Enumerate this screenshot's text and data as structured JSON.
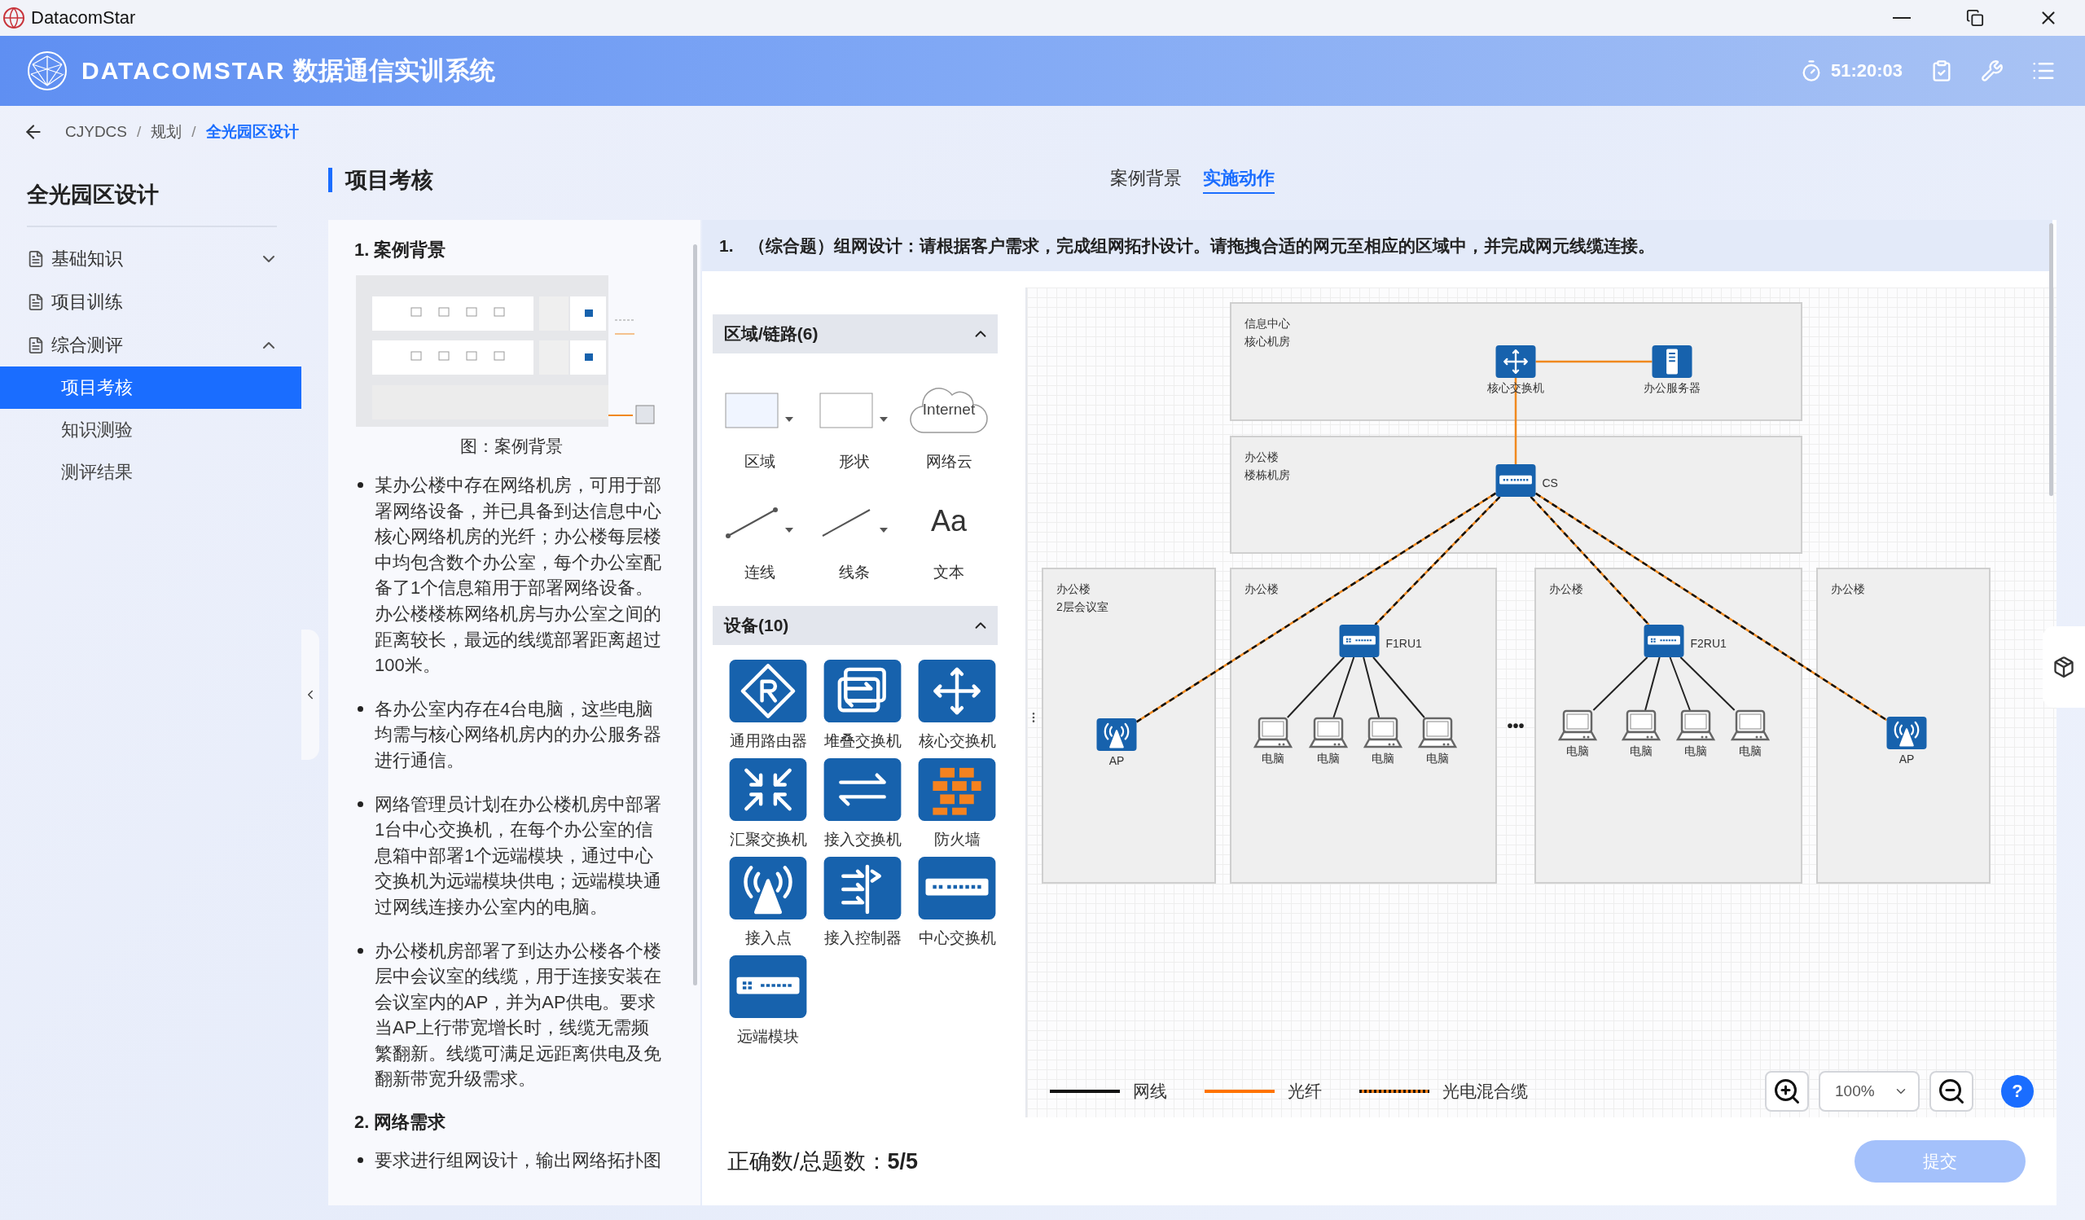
{
  "window": {
    "title": "DatacomStar"
  },
  "header": {
    "brand": "DATACOMSTAR",
    "title": "数据通信实训系统",
    "timer": "51:20:03"
  },
  "breadcrumb": {
    "separator": "/",
    "items": [
      {
        "label": "CJYDCS",
        "selected": false
      },
      {
        "label": "规划",
        "selected": false
      },
      {
        "label": "全光园区设计",
        "selected": true
      }
    ]
  },
  "sidebar": {
    "title": "全光园区设计",
    "items": [
      {
        "label": "基础知识",
        "expanded": false
      },
      {
        "label": "项目训练"
      },
      {
        "label": "综合测评",
        "expanded": true,
        "children": [
          {
            "label": "项目考核",
            "selected": true
          },
          {
            "label": "知识测验",
            "selected": false
          },
          {
            "label": "测评结果",
            "selected": false
          }
        ]
      }
    ]
  },
  "section": {
    "title": "项目考核",
    "tabs": [
      {
        "label": "案例背景",
        "selected": false
      },
      {
        "label": "实施动作",
        "selected": true
      }
    ]
  },
  "case_panel": {
    "heading": "1. 案例背景",
    "figure_caption": "图：案例背景",
    "bullets": [
      "某办公楼中存在网络机房，可用于部署网络设备，并已具备到达信息中心核心网络机房的光纤；办公楼每层楼中均包含数个办公室，每个办公室配备了1个信息箱用于部署网络设备。办公楼楼栋网络机房与办公室之间的距离较长，最远的线缆部署距离超过100米。",
      "各办公室内存在4台电脑，这些电脑均需与核心网络机房内的办公服务器进行通信。",
      "网络管理员计划在办公楼机房中部署1台中心交换机，在每个办公室的信息箱中部署1个远端模块，通过中心交换机为远端模块供电；远端模块通过网线连接办公室内的电脑。",
      "办公楼机房部署了到达办公楼各个楼层中会议室的线缆，用于连接安装在会议室内的AP，并为AP供电。要求当AP上行带宽增长时，线缆无需频繁翻新。线缆可满足远距离供电及免翻新带宽升级需求。"
    ],
    "heading_2": "2. 网络需求",
    "bullets_2": [
      "要求进行组网设计，输出网络拓扑图"
    ]
  },
  "question": {
    "number": "1.",
    "text": "（综合题）组网设计：请根据客户需求，完成组网拓扑设计。请拖拽合适的网元至相应的区域中，并完成网元线缆连接。"
  },
  "palette": {
    "sections": [
      {
        "title": "区域/链路(6)",
        "expanded": true,
        "items": [
          {
            "label": "区域",
            "kind": "zone"
          },
          {
            "label": "形状",
            "kind": "shape"
          },
          {
            "label": "网络云",
            "kind": "cloud",
            "glyph": "Internet"
          },
          {
            "label": "连线",
            "kind": "connector"
          },
          {
            "label": "线条",
            "kind": "line"
          },
          {
            "label": "文本",
            "kind": "text",
            "glyph": "Aa"
          }
        ]
      },
      {
        "title": "设备(10)",
        "expanded": true,
        "items": [
          {
            "label": "通用路由器",
            "kind": "router"
          },
          {
            "label": "堆叠交换机",
            "kind": "stacked-switch"
          },
          {
            "label": "核心交换机",
            "kind": "core-switch"
          },
          {
            "label": "汇聚交换机",
            "kind": "aggregation-switch"
          },
          {
            "label": "接入交换机",
            "kind": "access-switch"
          },
          {
            "label": "防火墙",
            "kind": "firewall"
          },
          {
            "label": "接入点",
            "kind": "ap"
          },
          {
            "label": "接入控制器",
            "kind": "ac"
          },
          {
            "label": "中心交换机",
            "kind": "central-switch"
          },
          {
            "label": "远端模块",
            "kind": "remote-module"
          }
        ]
      }
    ]
  },
  "canvas": {
    "zones": [
      {
        "lines": [
          "信息中心",
          "核心机房"
        ]
      },
      {
        "lines": [
          "办公楼",
          "楼栋机房"
        ]
      },
      {
        "lines": [
          "办公楼",
          "2层会议室"
        ]
      },
      {
        "lines": [
          "办公楼"
        ]
      },
      {
        "lines": [
          "办公楼"
        ]
      },
      {
        "lines": [
          "办公楼"
        ]
      }
    ],
    "nodes": [
      {
        "kind": "core-switch",
        "label": "核心交换机"
      },
      {
        "kind": "server",
        "label": "办公服务器"
      },
      {
        "kind": "central-switch",
        "label": "CS"
      },
      {
        "kind": "ap",
        "label": "AP"
      },
      {
        "kind": "remote-module",
        "label": "F1RU1"
      },
      {
        "kind": "pc",
        "label": "电脑"
      },
      {
        "kind": "pc",
        "label": "电脑"
      },
      {
        "kind": "pc",
        "label": "电脑"
      },
      {
        "kind": "pc",
        "label": "电脑"
      },
      {
        "kind": "remote-module",
        "label": "F2RU1"
      },
      {
        "kind": "pc",
        "label": "电脑"
      },
      {
        "kind": "pc",
        "label": "电脑"
      },
      {
        "kind": "pc",
        "label": "电脑"
      },
      {
        "kind": "pc",
        "label": "电脑"
      },
      {
        "kind": "ap",
        "label": "AP"
      }
    ],
    "links": [
      {
        "kind": "fiber"
      },
      {
        "kind": "fiber"
      },
      {
        "kind": "hybrid"
      },
      {
        "kind": "hybrid"
      },
      {
        "kind": "hybrid"
      },
      {
        "kind": "hybrid"
      },
      {
        "kind": "cable"
      },
      {
        "kind": "cable"
      },
      {
        "kind": "cable"
      },
      {
        "kind": "cable"
      },
      {
        "kind": "cable"
      },
      {
        "kind": "cable"
      },
      {
        "kind": "cable"
      },
      {
        "kind": "cable"
      }
    ],
    "ellipsis": "•••"
  },
  "legend": [
    {
      "label": "网线",
      "kind": "cable"
    },
    {
      "label": "光纤",
      "kind": "fiber"
    },
    {
      "label": "光电混合缆",
      "kind": "hybrid"
    }
  ],
  "zoom": {
    "value": "100%",
    "help": "?"
  },
  "footer": {
    "score_label": "正确数/总题数：",
    "score": "5/5",
    "submit": {
      "label": "提交",
      "disabled": true
    }
  }
}
